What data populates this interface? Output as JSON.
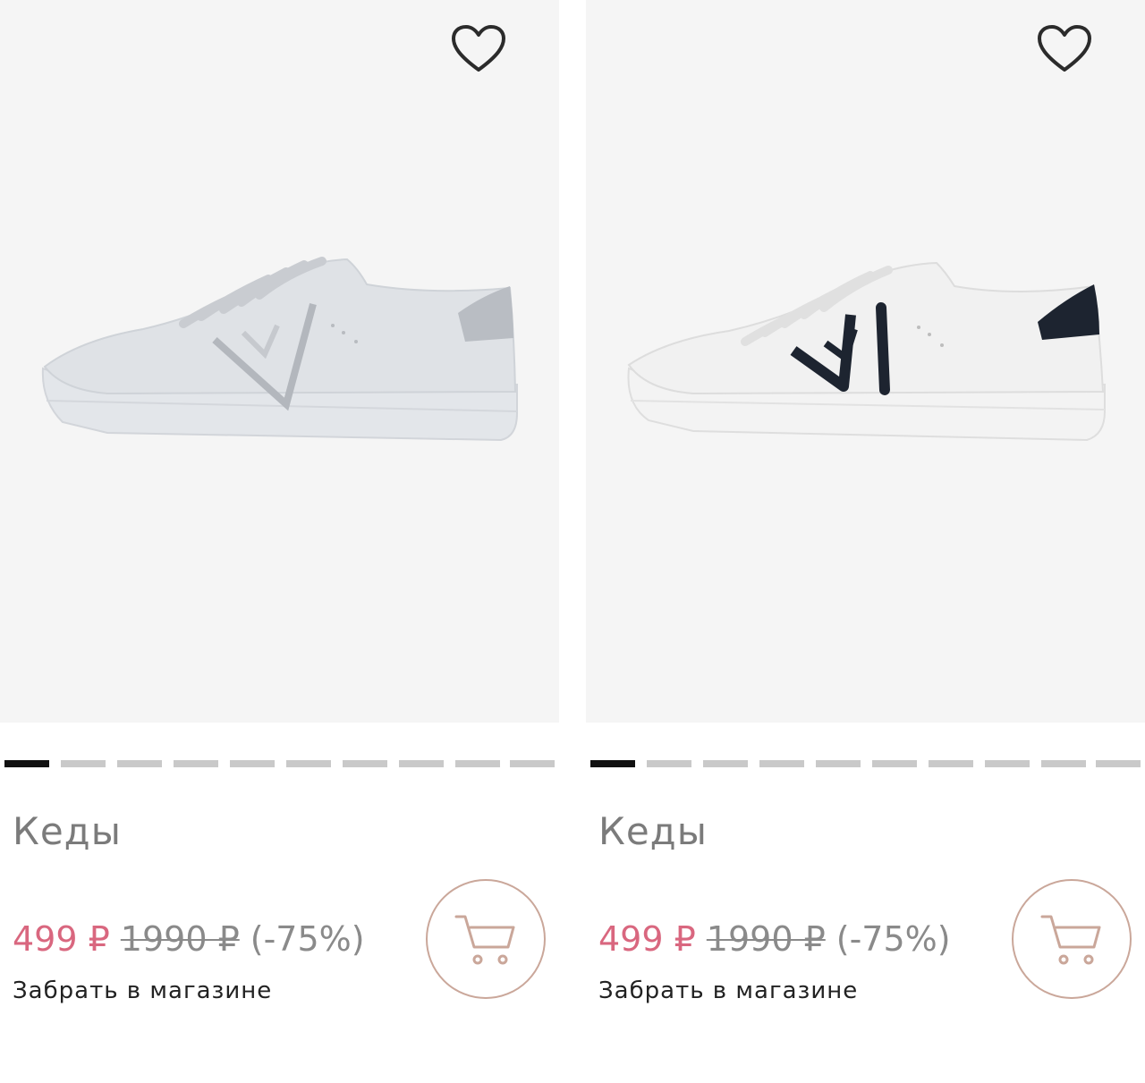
{
  "products": [
    {
      "title": "Кеды",
      "price_current": "499 ₽",
      "price_old": "1990 ₽",
      "discount": "(-75%)",
      "pickup_label": "Забрать в магазине",
      "carousel": {
        "total": 10,
        "active_index": 0
      },
      "colors": {
        "sole": "#e4e6ea",
        "upper": "#dde0e4",
        "accent": "#b8bcc2"
      }
    },
    {
      "title": "Кеды",
      "price_current": "499 ₽",
      "price_old": "1990 ₽",
      "discount": "(-75%)",
      "pickup_label": "Забрать в магазине",
      "carousel": {
        "total": 10,
        "active_index": 0
      },
      "colors": {
        "sole": "#f4f4f4",
        "upper": "#f1f1f1",
        "accent": "#1d2430"
      }
    }
  ],
  "colors": {
    "price_current": "#d9677f",
    "price_old": "#8a8a8a",
    "title": "#7b7b7b",
    "cart_border": "#caa79a",
    "image_bg": "#f5f5f5"
  }
}
